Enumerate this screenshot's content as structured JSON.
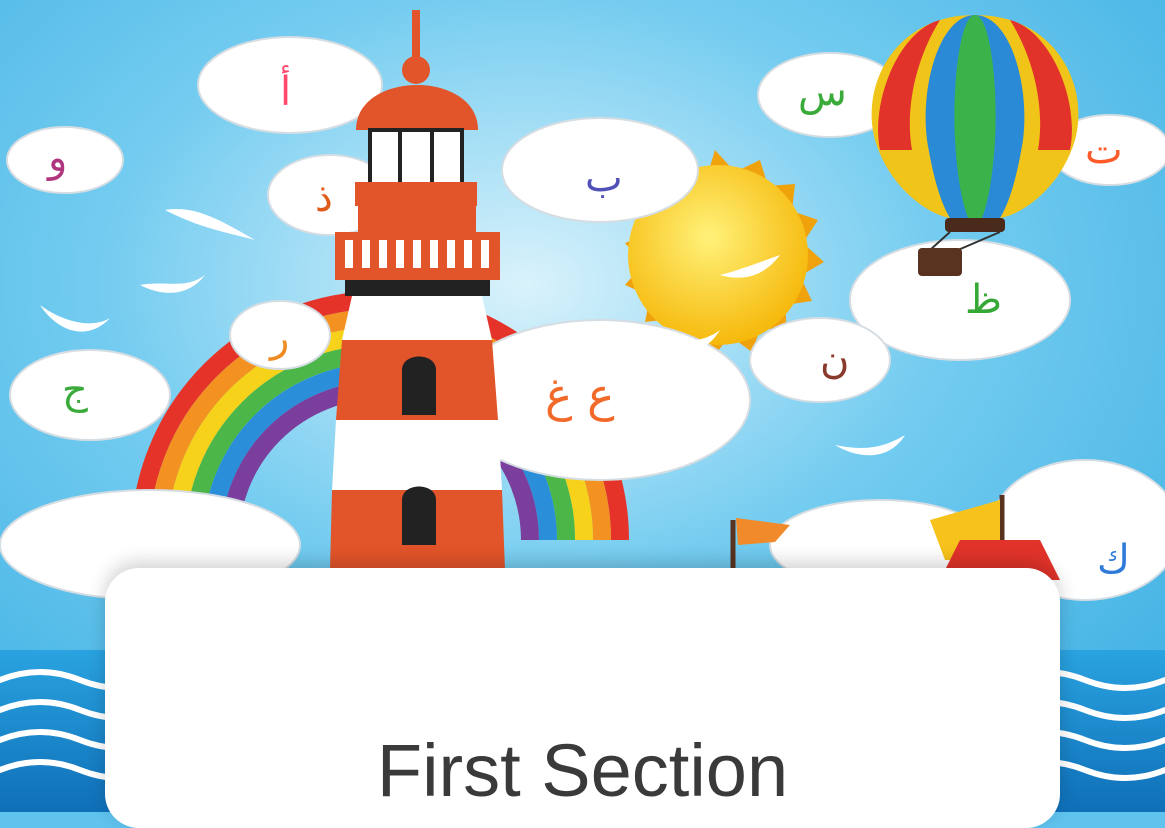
{
  "card": {
    "title": "First Section"
  },
  "letters": {
    "alif": "أ",
    "waw": "و",
    "dhal": "ذ",
    "ba": "ب",
    "sin": "س",
    "ta": "ت",
    "za": "ظ",
    "ra": "ر",
    "jim": "ج",
    "ain_ghain": "ع غ",
    "nun": "ن",
    "kaf": "ك"
  },
  "colors": {
    "sky": "#5fc3ee",
    "lighthouse_red": "#e2542a",
    "sun": "#f7c81c",
    "sea": "#1e8fd6",
    "card": "#ffffff",
    "title_text": "#3a3a3a"
  }
}
